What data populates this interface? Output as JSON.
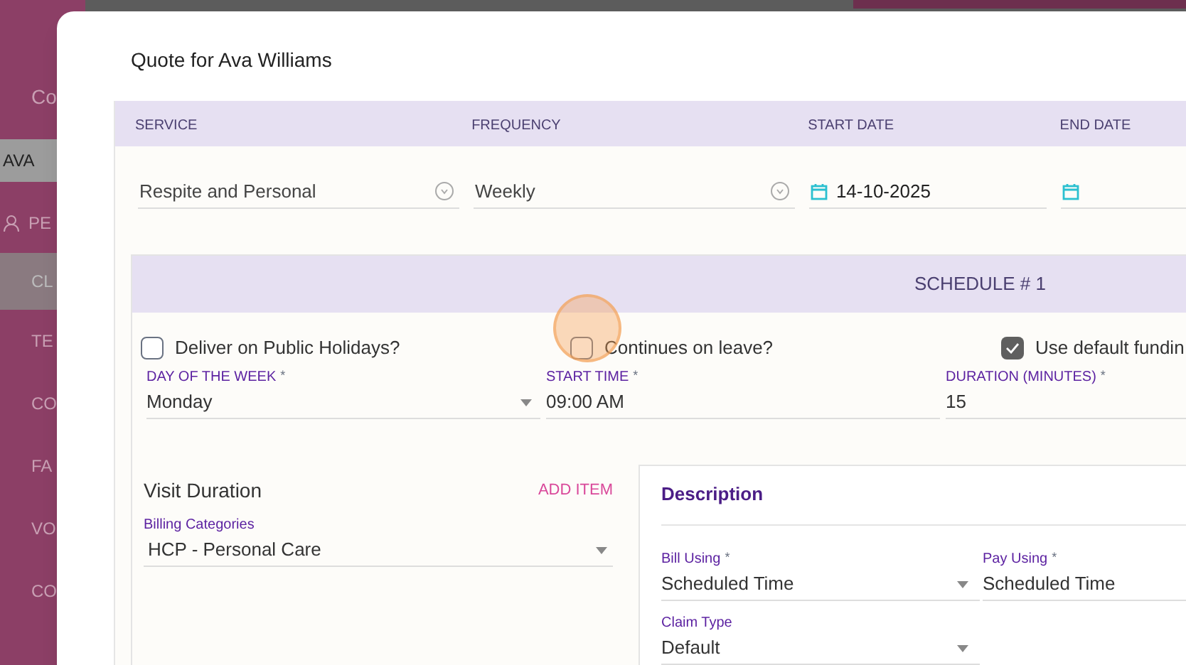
{
  "background": {
    "sidebar_subtitle": "Co",
    "sidebar_search": "AVA",
    "sidebar_items": [
      {
        "label": "PE",
        "kind": "icon",
        "selected": false
      },
      {
        "label": "CL",
        "kind": "text",
        "selected": true
      },
      {
        "label": "TE",
        "kind": "text",
        "selected": false
      },
      {
        "label": "CO",
        "kind": "text",
        "selected": false
      },
      {
        "label": "FA",
        "kind": "text",
        "selected": false
      },
      {
        "label": "VO",
        "kind": "text",
        "selected": false
      },
      {
        "label": "CO",
        "kind": "text",
        "selected": false
      }
    ]
  },
  "dialog": {
    "title": "Quote for Ava Williams",
    "columns": [
      {
        "label": "SERVICE",
        "value": "Respite and Personal",
        "kind": "select"
      },
      {
        "label": "FREQUENCY",
        "value": "Weekly",
        "kind": "select"
      },
      {
        "label": "START DATE",
        "value": "14-10-2025",
        "kind": "date"
      },
      {
        "label": "END DATE",
        "kind": "date"
      }
    ],
    "schedule": {
      "title": "SCHEDULE # 1",
      "options": [
        {
          "label": "Deliver on Public Holidays?",
          "checked": false
        },
        {
          "label": "Continues on leave?",
          "checked": false
        },
        {
          "label": "Use default fundin",
          "checked": true
        }
      ],
      "fields": [
        {
          "label": "DAY OF THE WEEK",
          "required_mark": "*",
          "value": "Monday",
          "kind": "select"
        },
        {
          "label": "START TIME",
          "required_mark": "*",
          "value": "09:00 AM",
          "kind": "text"
        },
        {
          "label": "DURATION (MINUTES)",
          "required_mark": "*",
          "value": "15",
          "kind": "text"
        }
      ],
      "visit_duration": {
        "title": "Visit Duration",
        "add_item": "ADD ITEM",
        "billing_label": "Billing Categories",
        "billing_value": "HCP - Personal Care"
      },
      "description": {
        "title": "Description",
        "fields": [
          {
            "label": "Bill Using",
            "required_mark": "*",
            "value": "Scheduled Time",
            "kind": "select"
          },
          {
            "label": "Pay Using",
            "required_mark": "*",
            "value": "Scheduled Time",
            "kind": "select"
          },
          {
            "label": "Claim Type",
            "value": "Default",
            "kind": "select"
          }
        ]
      }
    }
  }
}
